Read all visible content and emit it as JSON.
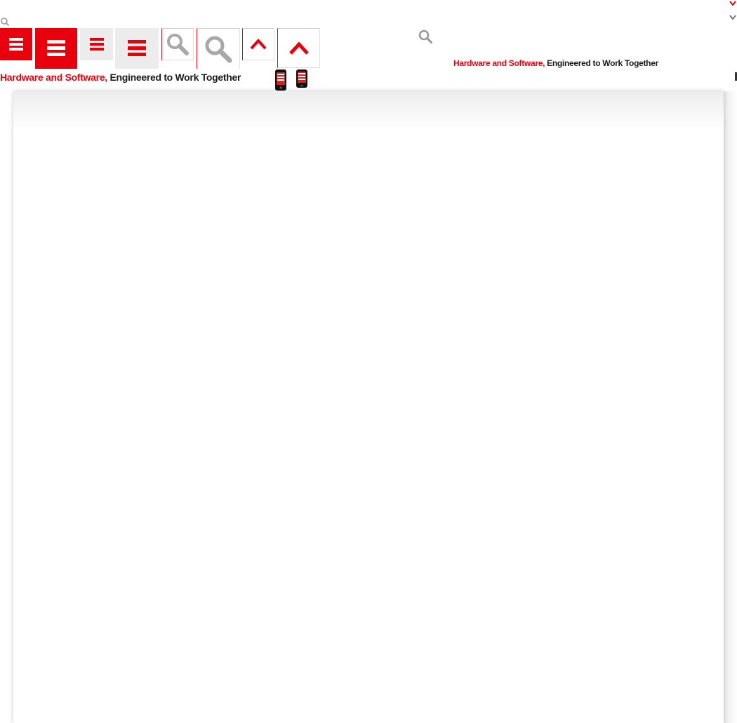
{
  "page": {
    "tagline_red": "Hardware and Software,",
    "tagline_dark": "Engineered to Work Together"
  },
  "icons": [
    "search-icon",
    "menu-icon",
    "search-magnifier-icon",
    "chevron-up-icon",
    "mobile-phone-icon",
    "chevron-down-icon"
  ],
  "colors": {
    "accent": "#e8000c",
    "tile_grey": "#ececec",
    "text_dark": "#1a1a1a",
    "icon_grey": "#9a9a9a"
  }
}
